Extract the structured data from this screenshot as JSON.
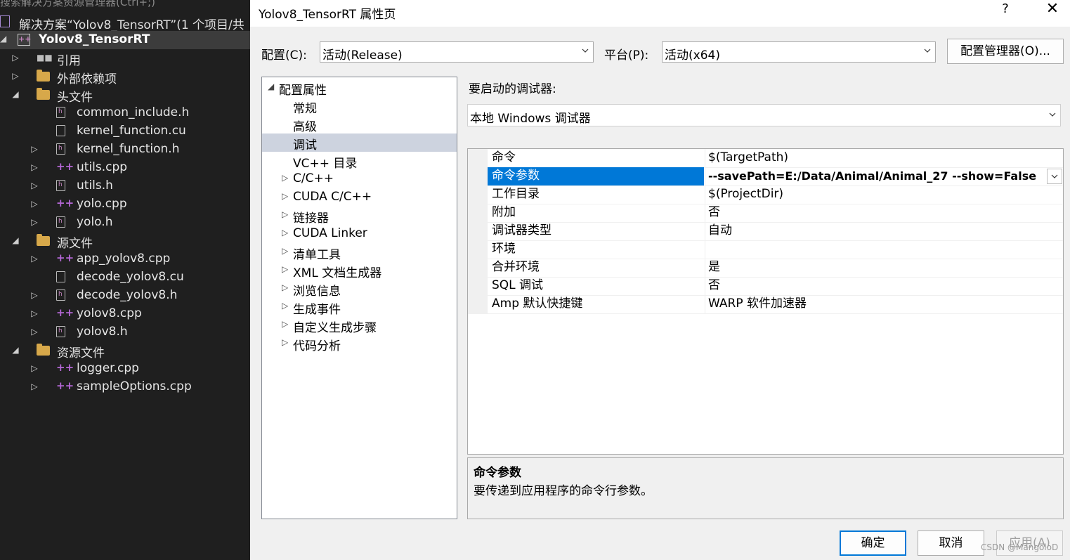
{
  "explorer": {
    "hint": "搜索解决方案资源管理器(Ctrl+;)",
    "solution": "解决方案“Yolov8_TensorRT”(1 个项目/共",
    "project": "Yolov8_TensorRT",
    "items": [
      {
        "label": "引用",
        "icon": "reference-icon"
      },
      {
        "label": "外部依赖项",
        "icon": "external-deps-icon"
      },
      {
        "label": "头文件",
        "icon": "folder-icon"
      },
      {
        "label": "common_include.h",
        "icon": "header-file-icon"
      },
      {
        "label": "kernel_function.cu",
        "icon": "file-icon"
      },
      {
        "label": "kernel_function.h",
        "icon": "header-file-icon"
      },
      {
        "label": "utils.cpp",
        "icon": "cpp-file-icon"
      },
      {
        "label": "utils.h",
        "icon": "header-file-icon"
      },
      {
        "label": "yolo.cpp",
        "icon": "cpp-file-icon"
      },
      {
        "label": "yolo.h",
        "icon": "header-file-icon"
      },
      {
        "label": "源文件",
        "icon": "folder-icon"
      },
      {
        "label": "app_yolov8.cpp",
        "icon": "cpp-file-icon"
      },
      {
        "label": "decode_yolov8.cu",
        "icon": "file-icon"
      },
      {
        "label": "decode_yolov8.h",
        "icon": "header-file-icon"
      },
      {
        "label": "yolov8.cpp",
        "icon": "cpp-file-icon"
      },
      {
        "label": "yolov8.h",
        "icon": "header-file-icon"
      },
      {
        "label": "资源文件",
        "icon": "folder-icon"
      },
      {
        "label": "logger.cpp",
        "icon": "cpp-file-icon"
      },
      {
        "label": "sampleOptions.cpp",
        "icon": "cpp-file-icon"
      }
    ]
  },
  "dialog": {
    "title": "Yolov8_TensorRT 属性页",
    "help": "?",
    "close": "✕",
    "config_label": "配置(C):",
    "config_value": "活动(Release)",
    "platform_label": "平台(P):",
    "platform_value": "活动(x64)",
    "config_manager": "配置管理器(O)...",
    "debugger_label": "要启动的调试器:",
    "debugger_value": "本地 Windows 调试器",
    "tree": [
      {
        "label": "配置属性",
        "arrow": "◢"
      },
      {
        "label": "常规"
      },
      {
        "label": "高级"
      },
      {
        "label": "调试"
      },
      {
        "label": "VC++ 目录"
      },
      {
        "label": "C/C++",
        "arrow": "▷"
      },
      {
        "label": "CUDA C/C++",
        "arrow": "▷"
      },
      {
        "label": "链接器",
        "arrow": "▷"
      },
      {
        "label": "CUDA Linker",
        "arrow": "▷"
      },
      {
        "label": "清单工具",
        "arrow": "▷"
      },
      {
        "label": "XML 文档生成器",
        "arrow": "▷"
      },
      {
        "label": "浏览信息",
        "arrow": "▷"
      },
      {
        "label": "生成事件",
        "arrow": "▷"
      },
      {
        "label": "自定义生成步骤",
        "arrow": "▷"
      },
      {
        "label": "代码分析",
        "arrow": "▷"
      }
    ],
    "props": [
      {
        "k": "命令",
        "v": "$(TargetPath)"
      },
      {
        "k": "命令参数",
        "v": "--savePath=E:/Data/Animal/Animal_27 --show=False"
      },
      {
        "k": "工作目录",
        "v": "$(ProjectDir)"
      },
      {
        "k": "附加",
        "v": "否"
      },
      {
        "k": "调试器类型",
        "v": "自动"
      },
      {
        "k": "环境",
        "v": ""
      },
      {
        "k": "合并环境",
        "v": "是"
      },
      {
        "k": "SQL 调试",
        "v": "否"
      },
      {
        "k": "Amp 默认快捷键",
        "v": "WARP 软件加速器"
      }
    ],
    "desc_title": "命令参数",
    "desc_body": "要传递到应用程序的命令行参数。",
    "ok": "确定",
    "cancel": "取消",
    "apply": "应用(A)"
  },
  "watermark": "CSDN @MangoloD",
  "colors": {
    "selection": "#0078d7",
    "tree_selection": "#cdd3df",
    "explorer_bg": "#1f1f1f"
  }
}
